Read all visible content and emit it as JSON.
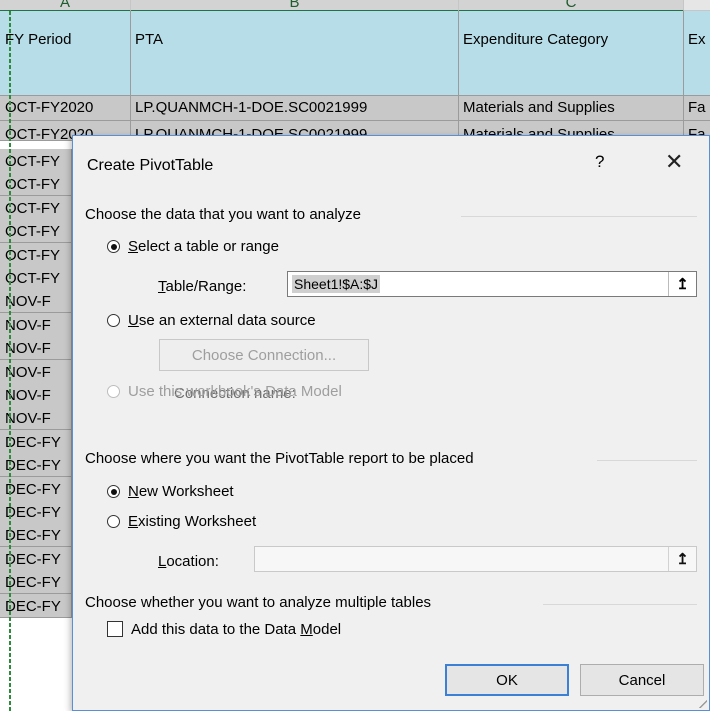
{
  "sheet": {
    "columns": [
      "A",
      "B",
      "C"
    ],
    "headers": [
      "FY Period",
      "PTA",
      "Expenditure Category",
      "Ex"
    ],
    "rows": [
      [
        "OCT-FY2020",
        "LP.QUANMCH-1-DOE.SC0021999",
        "Materials and Supplies",
        "Fa"
      ],
      [
        "OCT-FY2020",
        "LP.QUANMCH-1-DOE.SC0021999",
        "Materials and Supplies",
        "Fa"
      ]
    ],
    "col_a_partial": [
      "OCT-FY",
      "OCT-FY",
      "OCT-FY",
      "OCT-FY",
      "OCT-FY",
      "OCT-FY",
      "NOV-F",
      "NOV-F",
      "NOV-F",
      "NOV-F",
      "NOV-F",
      "NOV-F",
      "DEC-FY",
      "DEC-FY",
      "DEC-FY",
      "DEC-FY",
      "DEC-FY",
      "DEC-FY",
      "DEC-FY",
      "DEC-FY"
    ]
  },
  "dialog": {
    "title": "Create PivotTable",
    "help_glyph": "?",
    "close_glyph": "✕",
    "section_data": "Choose the data that you want to analyze",
    "opt_table_range": {
      "prefix": "",
      "accel": "S",
      "rest": "elect a table or range",
      "selected": true
    },
    "table_range": {
      "accel": "T",
      "rest": "able/Range:",
      "value": "Sheet1!$A:$J"
    },
    "opt_external": {
      "accel": "U",
      "rest": "se an external data source",
      "selected": false
    },
    "choose_connection": "Choose Connection...",
    "connection_name": "Connection name:",
    "opt_data_model": {
      "text": "Use this workbook's Data Model",
      "disabled": true
    },
    "section_place": "Choose where you want the PivotTable report to be placed",
    "opt_new_ws": {
      "accel": "N",
      "rest": "ew Worksheet",
      "selected": true
    },
    "opt_existing_ws": {
      "accel": "E",
      "rest": "xisting Worksheet",
      "selected": false
    },
    "location": {
      "accel": "L",
      "rest": "ocation:",
      "value": ""
    },
    "section_multi": "Choose whether you want to analyze multiple tables",
    "add_data_model": {
      "before": "Add this data to the Data ",
      "accel": "M",
      "after": "odel",
      "checked": false
    },
    "ok": "OK",
    "cancel": "Cancel"
  },
  "icons": {
    "ref_button": "collapse-dialog-icon"
  },
  "colors": {
    "accent": "#3c7fd6",
    "header_fill": "#b7dee8",
    "selection": "#2e8b3a"
  }
}
